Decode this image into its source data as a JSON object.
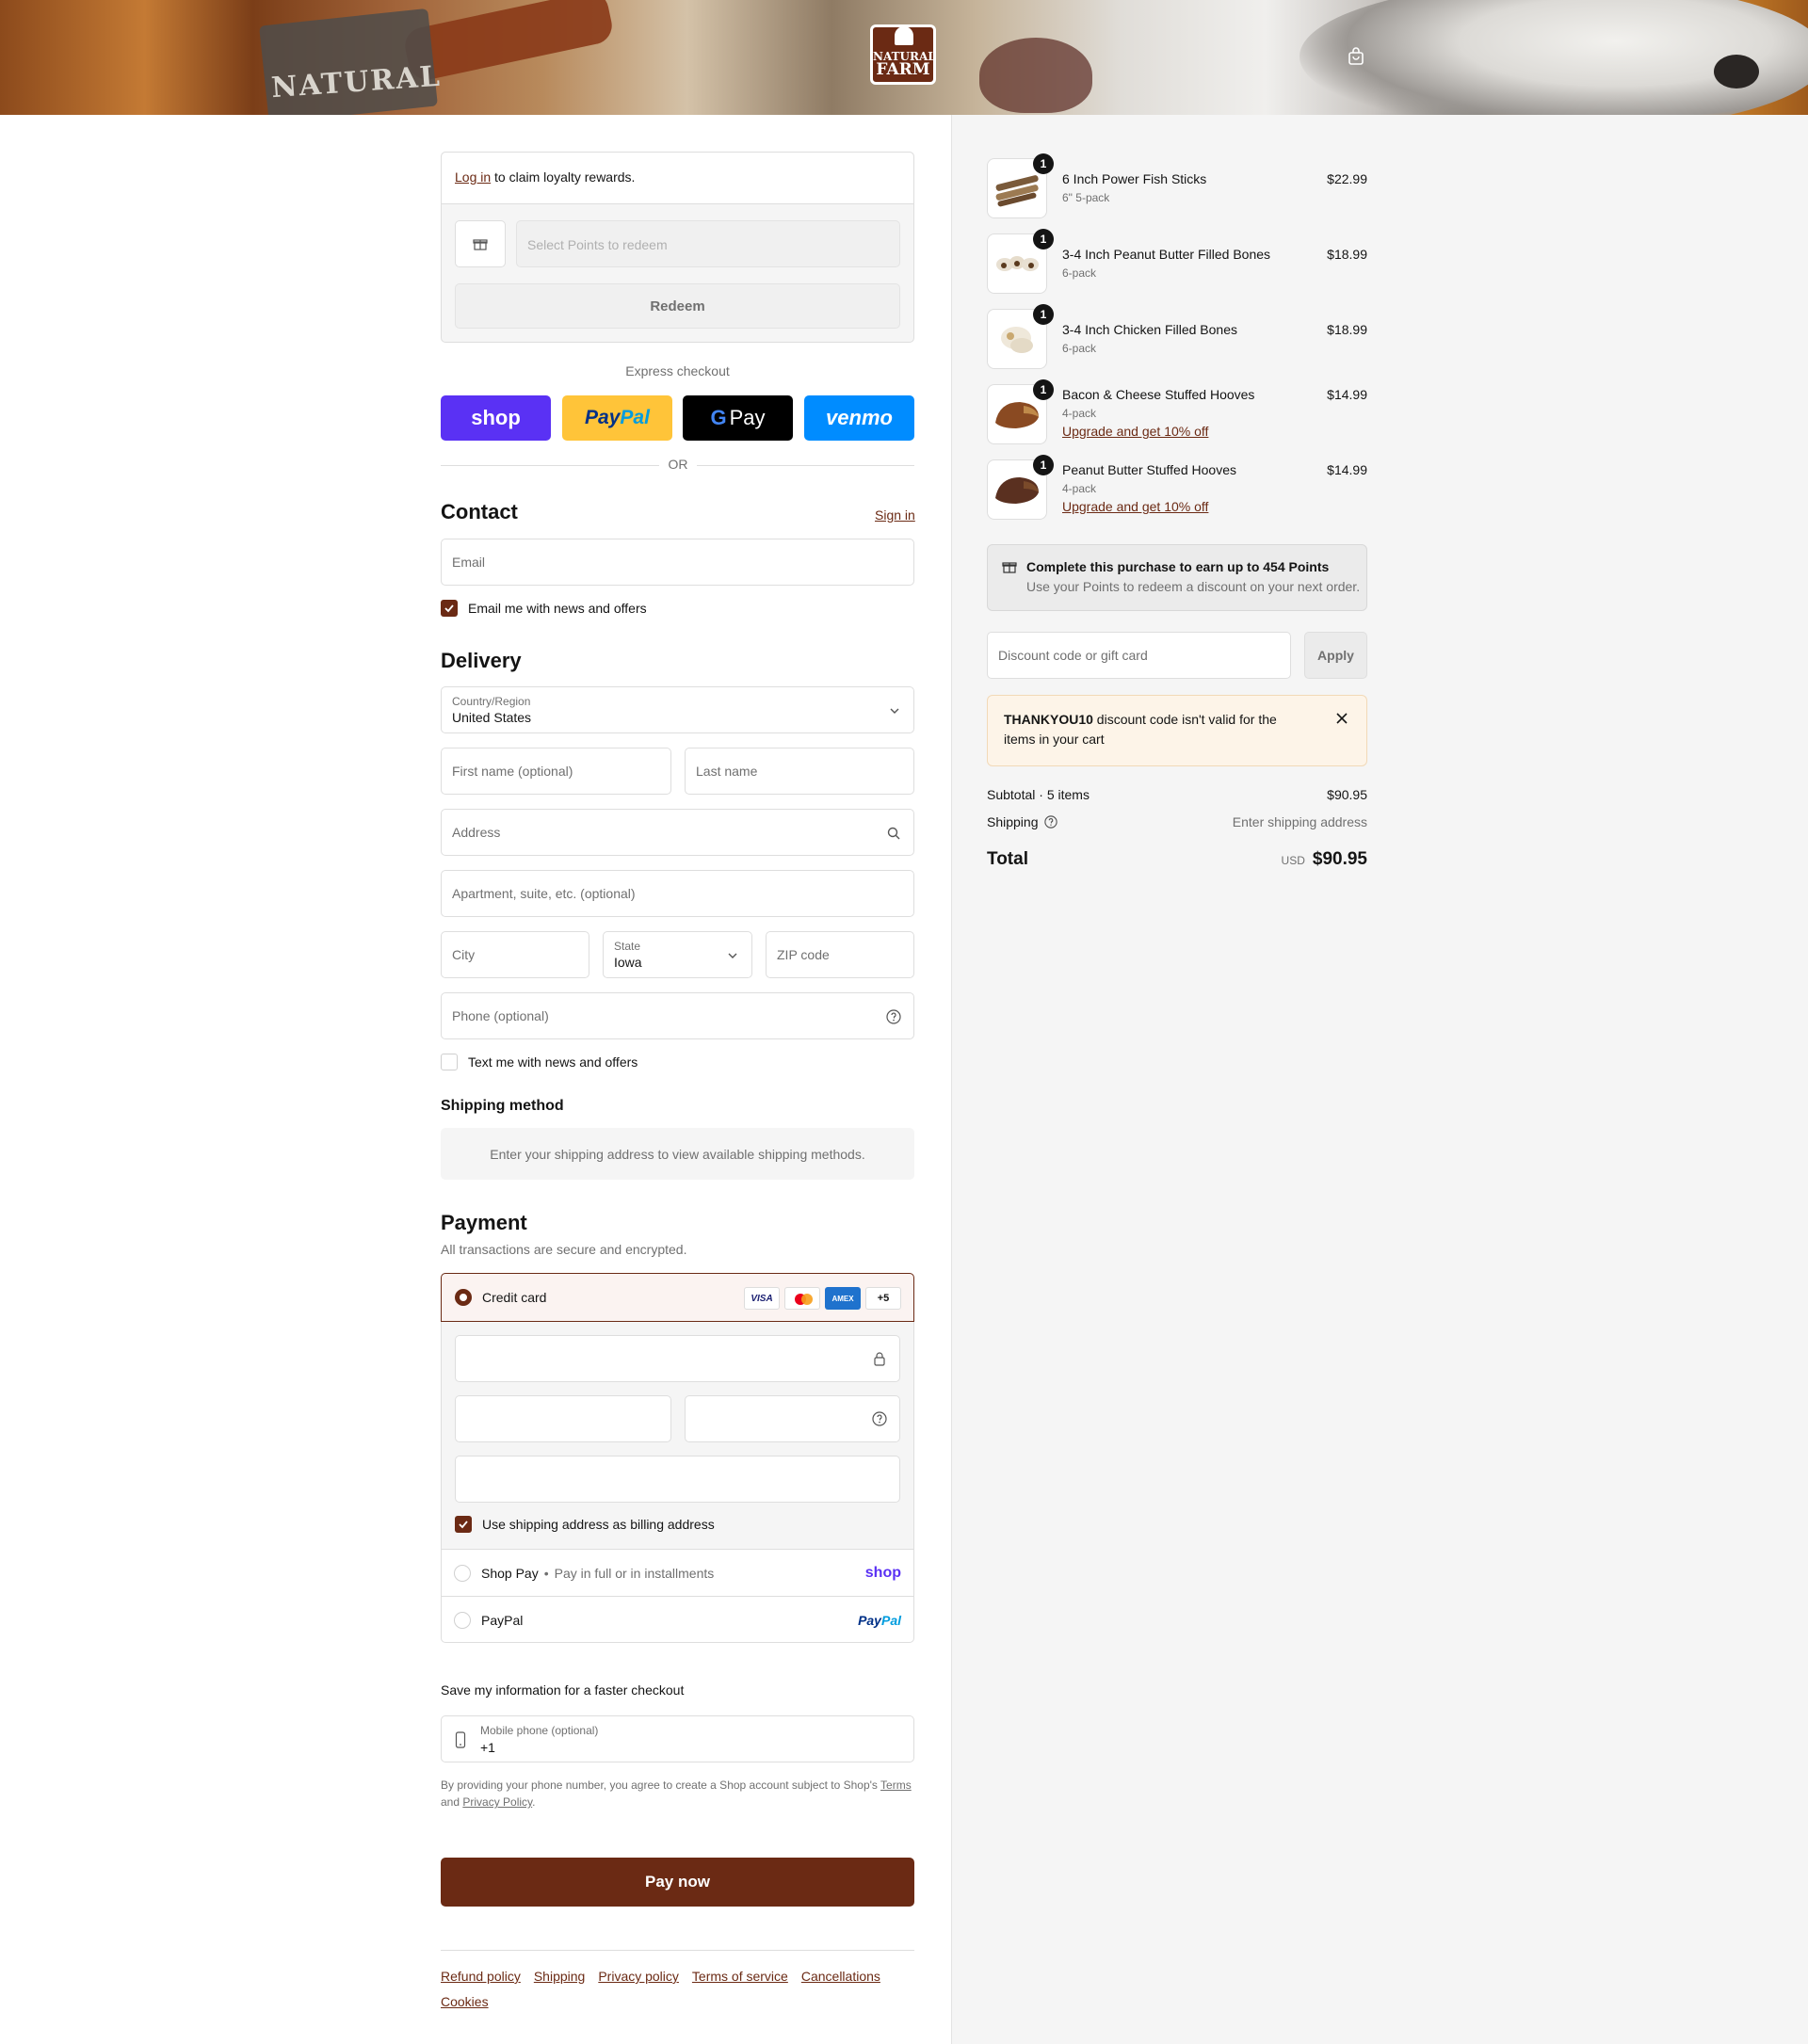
{
  "header": {
    "logo_line1": "NATURAL",
    "logo_line2": "FARM",
    "bag_text": "NATURAL"
  },
  "loyalty": {
    "login_link": "Log in",
    "login_text": " to claim loyalty rewards.",
    "select_placeholder": "Select Points to redeem",
    "redeem_label": "Redeem"
  },
  "express": {
    "title": "Express checkout",
    "shop": "shop",
    "paypal_a": "Pay",
    "paypal_b": "Pal",
    "gpay": "Pay",
    "venmo": "venmo",
    "or": "OR"
  },
  "contact": {
    "title": "Contact",
    "sign_in": "Sign in",
    "email_placeholder": "Email",
    "news_label": "Email me with news and offers"
  },
  "delivery": {
    "title": "Delivery",
    "country_label": "Country/Region",
    "country_value": "United States",
    "first_name": "First name (optional)",
    "last_name": "Last name",
    "address": "Address",
    "apartment": "Apartment, suite, etc. (optional)",
    "city": "City",
    "state_label": "State",
    "state_value": "Iowa",
    "zip": "ZIP code",
    "phone": "Phone (optional)",
    "text_label": "Text me with news and offers"
  },
  "shipping_method": {
    "title": "Shipping method",
    "placeholder": "Enter your shipping address to view available shipping methods."
  },
  "payment": {
    "title": "Payment",
    "subtitle": "All transactions are secure and encrypted.",
    "credit_card": "Credit card",
    "card_brands": [
      "VISA",
      "",
      "AMEX",
      "+5"
    ],
    "billing_label": "Use shipping address as billing address",
    "shop_pay": "Shop Pay",
    "shop_pay_sub": "Pay in full or in installments",
    "shop_pay_logo": "shop",
    "paypal": "PayPal",
    "paypal_logo_a": "Pay",
    "paypal_logo_b": "Pal"
  },
  "save_info": {
    "title": "Save my information for a faster checkout",
    "mobile_label": "Mobile phone (optional)",
    "mobile_value": "+1",
    "legal_a": "By providing your phone number, you agree to create a Shop account subject to Shop's ",
    "terms": "Terms",
    "legal_b": "and ",
    "privacy": "Privacy Policy",
    "legal_c": "."
  },
  "pay_now": "Pay now",
  "footer_links": [
    "Refund policy",
    "Shipping",
    "Privacy policy",
    "Terms of service",
    "Cancellations",
    "Cookies"
  ],
  "cart": {
    "items": [
      {
        "name": "6 Inch Power Fish Sticks",
        "variant": "6\" 5-pack",
        "price": "$22.99",
        "qty": "1",
        "upgrade": ""
      },
      {
        "name": "3-4 Inch Peanut Butter Filled Bones",
        "variant": "6-pack",
        "price": "$18.99",
        "qty": "1",
        "upgrade": ""
      },
      {
        "name": "3-4 Inch Chicken Filled Bones",
        "variant": "6-pack",
        "price": "$18.99",
        "qty": "1",
        "upgrade": ""
      },
      {
        "name": "Bacon & Cheese Stuffed Hooves",
        "variant": "4-pack",
        "price": "$14.99",
        "qty": "1",
        "upgrade": "Upgrade and get 10% off"
      },
      {
        "name": "Peanut Butter Stuffed Hooves",
        "variant": "4-pack",
        "price": "$14.99",
        "qty": "1",
        "upgrade": "Upgrade and get 10% off"
      }
    ],
    "points_title": "Complete this purchase to earn up to 454 Points",
    "points_sub": "Use your Points to redeem a discount on your next order.",
    "discount_placeholder": "Discount code or gift card",
    "apply": "Apply",
    "error_code": "THANKYOU10",
    "error_text": " discount code isn't valid for the items in your cart",
    "subtotal_label": "Subtotal · 5 items",
    "subtotal_value": "$90.95",
    "shipping_label": "Shipping",
    "shipping_value": "Enter shipping address",
    "total_label": "Total",
    "currency": "USD",
    "total_value": "$90.95"
  },
  "colors": {
    "brand": "#6b2a14",
    "shop": "#5a31f4",
    "paypal": "#ffc439",
    "venmo": "#008cff"
  }
}
